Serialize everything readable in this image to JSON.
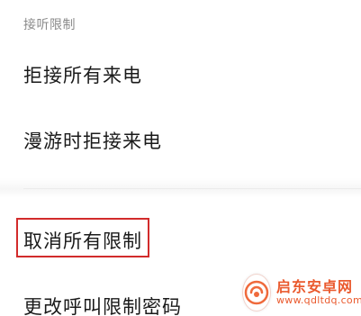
{
  "section": {
    "header": "接听限制"
  },
  "items": [
    {
      "label": "拒接所有来电"
    },
    {
      "label": "漫游时拒接来电"
    },
    {
      "label": "取消所有限制"
    },
    {
      "label": "更改呼叫限制密码"
    }
  ],
  "highlight": {
    "color": "#d22b2b"
  },
  "watermark": {
    "name": "启东安卓网",
    "url": "www.qdltdq.com",
    "icon": "app-logo-icon",
    "color": "#ea5a2e"
  }
}
